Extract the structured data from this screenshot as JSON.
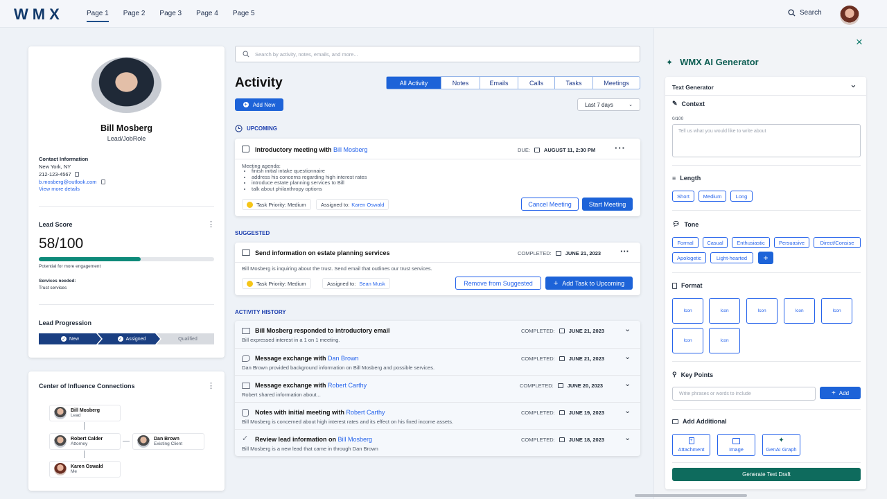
{
  "header": {
    "logo": "WMX",
    "nav": [
      "Page 1",
      "Page 2",
      "Page 3",
      "Page 4",
      "Page 5"
    ],
    "search_label": "Search"
  },
  "profile": {
    "name": "Bill Mosberg",
    "role": "Lead/JobRole",
    "contact_title": "Contact Information",
    "city": "New York, NY",
    "phone": "212-123-4567",
    "email": "b.mosberg@outlook.com",
    "view_more": "View more details",
    "lead_score_title": "Lead Score",
    "score": "58/100",
    "score_fraction": 0.58,
    "score_note": "Potential for more engagement",
    "services_label": "Services needed:",
    "services": "Trust services",
    "progression_title": "Lead Progression",
    "steps": [
      "New",
      "Assigned",
      "Qualified"
    ]
  },
  "coi": {
    "title": "Center of Influence Connections",
    "people": [
      {
        "name": "Bill Mosberg",
        "role": "Lead"
      },
      {
        "name": "Robert Calder",
        "role": "Attorney"
      },
      {
        "name": "Dan Brown",
        "role": "Existing Client"
      },
      {
        "name": "Karen Oswald",
        "role": "Me"
      }
    ]
  },
  "activity": {
    "search_placeholder": "Search by activity, notes, emails, and more...",
    "title": "Activity",
    "tabs": [
      "All Activity",
      "Notes",
      "Emails",
      "Calls",
      "Tasks",
      "Meetings"
    ],
    "add_new": "Add New",
    "range": "Last 7 days",
    "upcoming_label": "UPCOMING",
    "upcoming": {
      "title_prefix": "Introductory meeting with ",
      "title_link": "Bill Mosberg",
      "due_label": "DUE:",
      "due": "AUGUST 11, 2:30 PM",
      "agenda_title": "Meeting agenda:",
      "agenda": [
        "finish initial intake questionnaire",
        "address his concerns regarding high interest rates",
        "introduce estate planning services to Bill",
        "talk about philanthropy options"
      ],
      "priority": "Task Priority: Medium",
      "assigned_label": "Assigned to:",
      "assigned": "Karen Oswald",
      "cancel": "Cancel Meeting",
      "start": "Start Meeting"
    },
    "suggested_label": "SUGGESTED",
    "suggested": {
      "title": "Send information on estate planning services",
      "status": "COMPLETED:",
      "date": "JUNE 21, 2023",
      "desc": "Bill Mosberg is inquiring about the trust. Send email that outlines our trust services.",
      "priority": "Task Priority: Medium",
      "assigned_label": "Assigned to:",
      "assigned": "Sean Musk",
      "remove": "Remove from Suggested",
      "add_task": "Add Task to Upcoming"
    },
    "history_label": "ACTIVITY HISTORY",
    "history": [
      {
        "title": "Bill Mosberg responded to introductory email",
        "link": "",
        "status": "COMPLETED:",
        "date": "JUNE 21, 2023",
        "desc": "Bill expressed interest in a 1 on 1 meeting.",
        "icon": "mail-icon"
      },
      {
        "title": "Message exchange with ",
        "link": "Dan Brown",
        "status": "COMPLETED:",
        "date": "JUNE 21, 2023",
        "desc": "Dan Brown provided background information on Bill Mosberg and possible services.",
        "icon": "chat-icon"
      },
      {
        "title": "Message exchange with ",
        "link": "Robert Carthy",
        "status": "COMPLETED:",
        "date": "JUNE 20, 2023",
        "desc": "Robert shared information about...",
        "icon": "mail-icon"
      },
      {
        "title": "Notes with initial meeting with ",
        "link": "Robert Carthy",
        "status": "COMPLETED:",
        "date": "JUNE 19, 2023",
        "desc": "Bill Mosberg is concerned about high interest rates and its effect on his fixed income assets.",
        "icon": "notes-icon"
      },
      {
        "title": "Review lead information on ",
        "link": "Bill Mosberg",
        "status": "COMPLETED:",
        "date": "JUNE 18, 2023",
        "desc": "Bill Mosberg is a new lead that came in through Dan Brown",
        "icon": "check-icon"
      }
    ]
  },
  "ai": {
    "title": "WMX AI Generator",
    "generator": "Text Generator",
    "context": "Context",
    "counter": "0/100",
    "context_placeholder": "Tell us what you would like to write about",
    "length": "Length",
    "lengths": [
      "Short",
      "Medium",
      "Long"
    ],
    "tone": "Tone",
    "tones": [
      "Formal",
      "Casual",
      "Enthusiastic",
      "Persuasive",
      "Direct/Consise",
      "Apologetic",
      "Light-hearted"
    ],
    "format": "Format",
    "format_items": [
      "Icon",
      "Icon",
      "Icon",
      "Icon",
      "Icon",
      "Icon",
      "Icon"
    ],
    "key_points": "Key Points",
    "key_placeholder": "Write phrases or words to include",
    "add": "Add",
    "add_additional": "Add Additional",
    "additional": [
      "Attachment",
      "Image",
      "GenAI Graph"
    ],
    "generate": "Generate Text Draft"
  }
}
